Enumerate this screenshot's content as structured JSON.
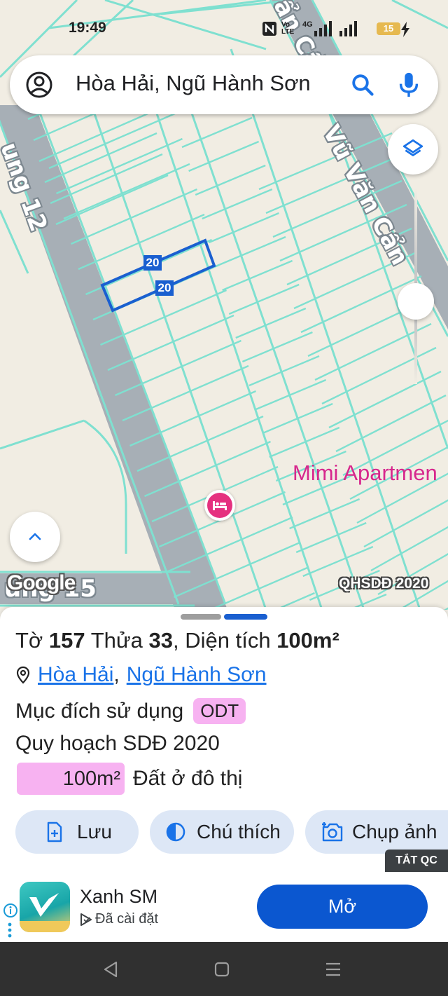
{
  "status_bar": {
    "time": "19:49",
    "network_label": "4G",
    "volte_label": "Vo LTE",
    "battery_level": "15"
  },
  "search": {
    "query": "Hòa Hải, Ngũ Hành Sơn"
  },
  "map": {
    "road_labels": [
      "Vũ Văn Cẩn",
      "ẩn Cẩ",
      "ung 12",
      "ung 15"
    ],
    "parcel_dimension_labels": [
      "20",
      "20"
    ],
    "place_name": "Mimi Apartmen",
    "place_icon": "bed-icon",
    "attribution": "Google",
    "overlay_tag": "QHSDĐ 2020"
  },
  "parcel": {
    "sheet_label": "Tờ",
    "sheet_number": "157",
    "plot_label": "Thửa",
    "plot_number": "33",
    "area_label": "Diện tích",
    "area_value": "100m²",
    "ward_link": "Hòa Hải",
    "separator": ",",
    "district_link": "Ngũ Hành Sơn",
    "purpose_label": "Mục đích sử dụng",
    "purpose_code": "ODT",
    "plan_label": "Quy hoạch SDĐ 2020",
    "plan_area": "100m²",
    "plan_type": "Đất ở đô thị"
  },
  "actions": {
    "save_label": "Lưu",
    "legend_label": "Chú thích",
    "capture_label": "Chụp ảnh"
  },
  "ad": {
    "close_label": "TẮT QC",
    "app_name": "Xanh SM",
    "install_status": "Đã cài đặt",
    "open_label": "Mở"
  },
  "colors": {
    "parcel_line": "#7fe0d0",
    "road": "#a7afb6",
    "selected_parcel": "#1a5fd0",
    "accent": "#0b57d0",
    "zoning_pink": "#f7b2f1",
    "place_pink": "#d7278d"
  }
}
